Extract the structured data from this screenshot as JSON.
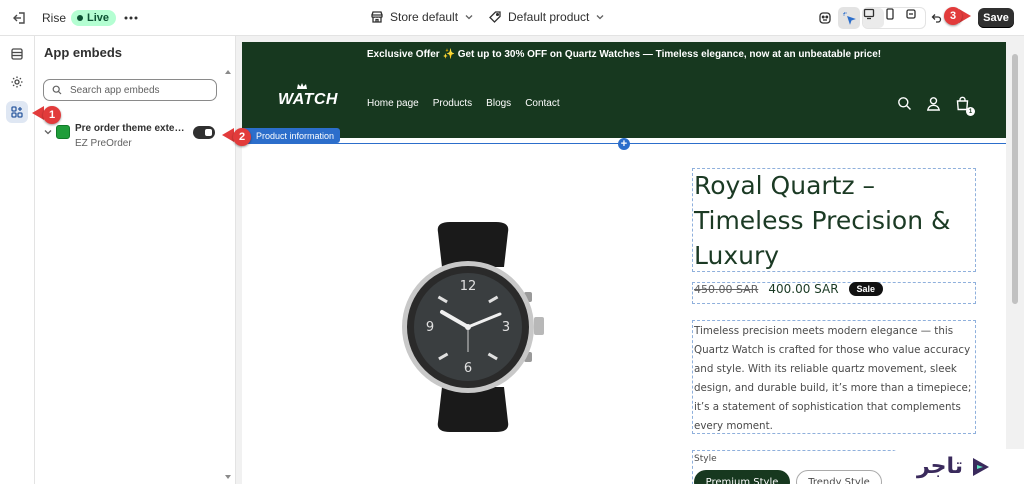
{
  "topbar": {
    "theme_name": "Rise",
    "live_label": "Live",
    "store_selector": "Store default",
    "product_selector": "Default product",
    "save_label": "Save"
  },
  "panel": {
    "title": "App embeds",
    "search_placeholder": "Search app embeds",
    "embed": {
      "name": "Pre order theme extensi...",
      "app": "EZ PreOrder",
      "enabled": true
    }
  },
  "preview": {
    "announcement": "Exclusive Offer ✨ Get up to 30% OFF on Quartz Watches — Timeless elegance, now at an unbeatable price!",
    "logo": "WATCH",
    "nav": [
      "Home page",
      "Products",
      "Blogs",
      "Contact"
    ],
    "cart_count": "1",
    "section_tag": "Product information",
    "product": {
      "title": "Royal Quartz – Timeless Precision & Luxury",
      "price_old": "450.00 SAR",
      "price_new": "400.00 SAR",
      "sale_badge": "Sale",
      "description": "Timeless precision meets modern elegance — this Quartz Watch is crafted for those who value accuracy and style. With its reliable quartz movement, sleek design, and durable build, it’s more than a timepiece; it’s a statement of sophistication that complements every moment.",
      "style_label": "Style",
      "styles": [
        "Premium Style",
        "Trendy Style"
      ]
    }
  },
  "markers": [
    "1",
    "2",
    "3"
  ],
  "brand": {
    "text": "تاجر"
  },
  "colors": {
    "header_green": "#17381f",
    "accent_blue": "#2c6ecb",
    "marker_red": "#e23b3b",
    "live_bg": "#b4fed2"
  }
}
